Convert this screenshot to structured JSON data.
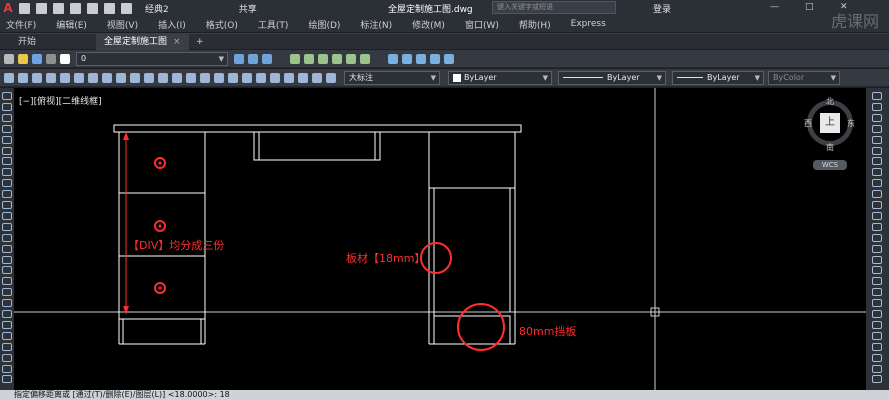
{
  "app": {
    "logo": "A"
  },
  "titlebar": {
    "workspace": "经典2",
    "share": "共享",
    "title": "全屋定制施工图.dwg",
    "search_placeholder": "键入关键字或短语",
    "login": "登录"
  },
  "menu": [
    "文件(F)",
    "编辑(E)",
    "视图(V)",
    "插入(I)",
    "格式(O)",
    "工具(T)",
    "绘图(D)",
    "标注(N)",
    "修改(M)",
    "窗口(W)",
    "帮助(H)",
    "Express"
  ],
  "watermark": "虎课网",
  "tabs": [
    {
      "label": "开始",
      "active": false
    },
    {
      "label": "全屋定制施工图",
      "active": true
    },
    {
      "label": "+",
      "active": false
    }
  ],
  "toolbar2": {
    "layer_value": "0"
  },
  "toolbar3": {
    "dimstyle": "大标注",
    "color": "ByLayer",
    "linetype": "ByLayer",
    "lineweight": "ByLayer",
    "plotstyle": "ByColor"
  },
  "viewport": {
    "label": "[−][俯视][二维线框]"
  },
  "annotations": {
    "div": "【DIV】均分成三份",
    "board": "板材【18mm】",
    "kick": "80mm挡板"
  },
  "navcube": {
    "top": "上",
    "north": "北",
    "south": "南",
    "east": "东",
    "west": "西",
    "wcs": "WCS"
  },
  "command": {
    "text": "指定偏移距离或 [通过(T)/删除(E)/图层(L)] <18.0000>: 18"
  },
  "colors": {
    "annotation": "#ff2e2e",
    "drawing": "#ffffff",
    "canvas": "#000000"
  }
}
